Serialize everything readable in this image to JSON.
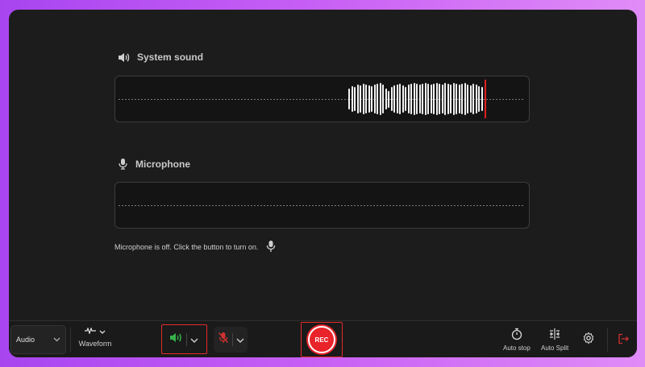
{
  "system_sound": {
    "title": "System sound",
    "icon": "speaker-icon",
    "levels": [
      0.6,
      0.75,
      0.7,
      0.85,
      0.8,
      0.9,
      0.85,
      0.8,
      0.75,
      0.85,
      0.9,
      0.95,
      0.85,
      0.6,
      0.5,
      0.7,
      0.8,
      0.85,
      0.9,
      0.8,
      0.7,
      0.85,
      0.9,
      0.95,
      0.9,
      0.85,
      0.9,
      0.95,
      0.9,
      0.85,
      0.9,
      0.95,
      0.9,
      0.85,
      0.95,
      0.9,
      0.85,
      0.95,
      0.9,
      0.85,
      0.9,
      0.95,
      0.85,
      0.8,
      0.9,
      0.85,
      0.75,
      0.7
    ]
  },
  "microphone": {
    "title": "Microphone",
    "icon": "microphone-icon",
    "note": "Microphone is off. Click the button to turn on."
  },
  "toolbar": {
    "mode_label": "Audio",
    "waveform_label": "Waveform",
    "rec_label": "REC",
    "auto_stop_label": "Auto stop",
    "auto_split_label": "Auto Split"
  },
  "colors": {
    "accent_red": "#e32b2b",
    "speaker_green": "#35b24a",
    "mic_off_red": "#d03030"
  }
}
